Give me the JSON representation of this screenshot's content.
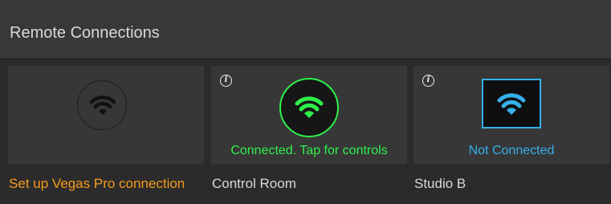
{
  "header": {
    "title": "Remote Connections"
  },
  "tiles": [
    {
      "label": "Set up Vegas Pro connection",
      "status": "",
      "state": "setup",
      "icon": "wifi-icon",
      "label_color": "#f59b1f"
    },
    {
      "label": "Control Room",
      "status": "Connected. Tap for controls",
      "state": "connected",
      "icon": "wifi-icon",
      "accent": "#2ef04b"
    },
    {
      "label": "Studio B",
      "status": "Not Connected",
      "state": "not-connected",
      "icon": "wifi-icon",
      "accent": "#34b0ea"
    }
  ],
  "info_icon": {
    "glyph": "i"
  }
}
